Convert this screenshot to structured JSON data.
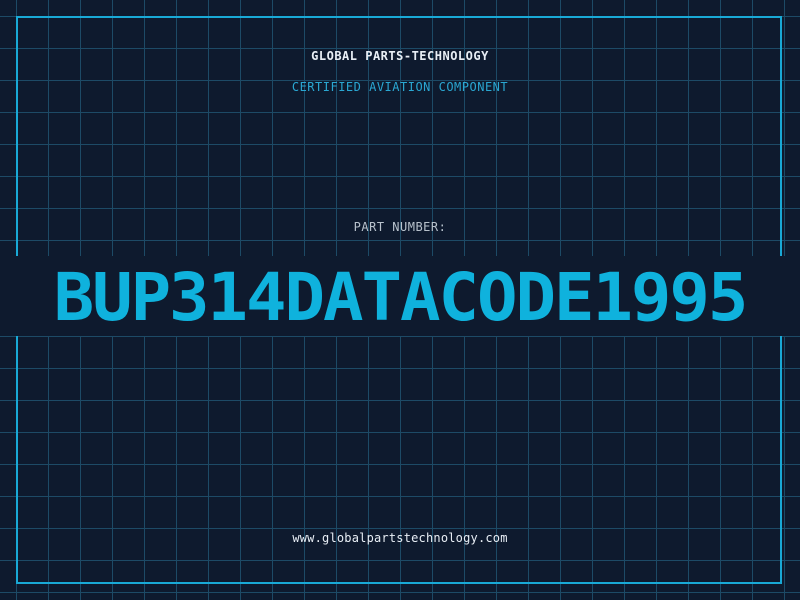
{
  "header": {
    "company": "GLOBAL PARTS-TECHNOLOGY",
    "subtitle": "CERTIFIED AVIATION COMPONENT"
  },
  "part": {
    "label": "PART NUMBER:",
    "number": "BUP314DATACODE1995"
  },
  "footer": {
    "url": "www.globalpartstechnology.com"
  },
  "colors": {
    "background": "#0e1a2e",
    "grid": "#1d4a66",
    "accent": "#0fb2dd",
    "text": "#e8eef5"
  }
}
